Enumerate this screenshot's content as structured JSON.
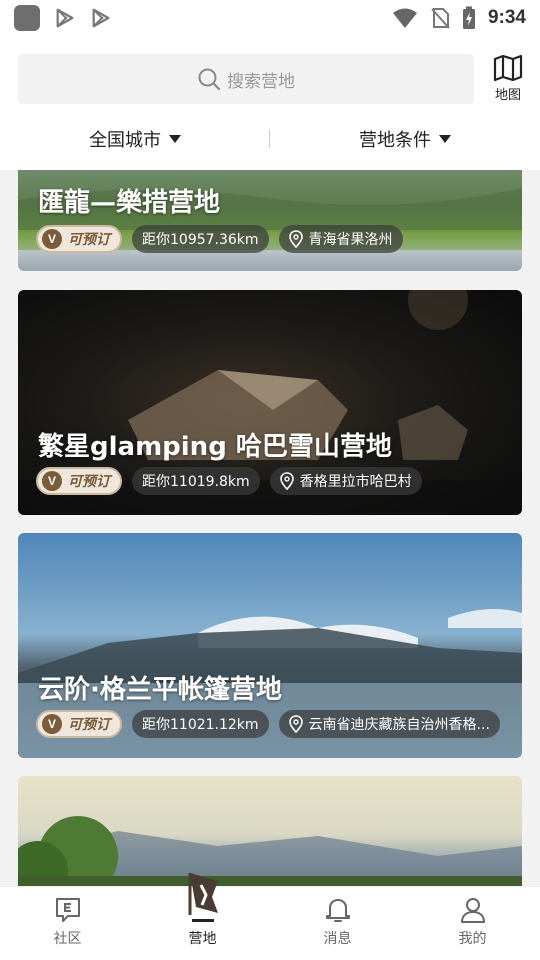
{
  "status_bar": {
    "time": "9:34"
  },
  "search": {
    "placeholder": "搜索营地"
  },
  "map_button": {
    "label": "地图"
  },
  "filters": [
    {
      "label": "全国城市"
    },
    {
      "label": "营地条件"
    }
  ],
  "camps": [
    {
      "name": "匯龍—樂措营地",
      "badge": "可预订",
      "distance": "距你10957.36km",
      "location": "青海省果洛州"
    },
    {
      "name": "繁星glamping 哈巴雪山营地",
      "badge": "可预订",
      "distance": "距你11019.8km",
      "location": "香格里拉市哈巴村"
    },
    {
      "name": "云阶·格兰平帐篷营地",
      "badge": "可预订",
      "distance": "距你11021.12km",
      "location": "云南省迪庆藏族自治州香格..."
    }
  ],
  "bottom_nav": [
    {
      "label": "社区"
    },
    {
      "label": "营地"
    },
    {
      "label": "消息"
    },
    {
      "label": "我的"
    }
  ],
  "colors": {
    "accent_brown": "#7a5b3a",
    "badge_bg": "#efe6dc"
  }
}
